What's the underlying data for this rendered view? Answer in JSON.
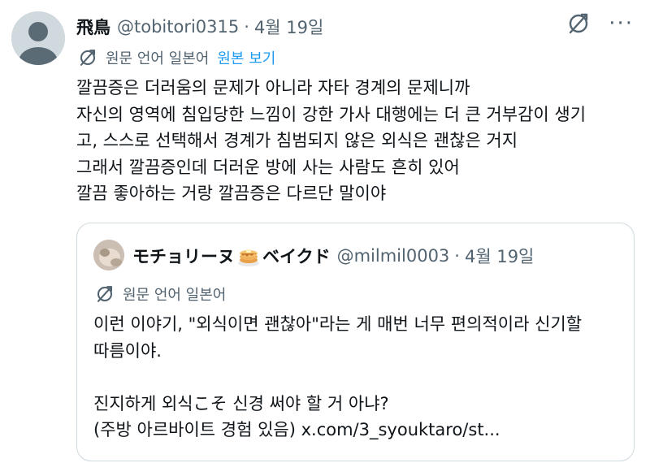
{
  "tweet": {
    "display_name": "飛鳥",
    "handle": "@tobitori0315",
    "separator": "·",
    "date": "4월 19일",
    "translate": {
      "label": "원문 언어 일본어",
      "show_original": "원본 보기"
    },
    "body_lines": [
      "깔끔증은 더러움의 문제가 아니라 자타 경계의 문제니까",
      "자신의 영역에 침입당한 느낌이 강한 가사 대행에는 더 큰 거부감이 생기",
      "고, 스스로 선택해서 경계가 침범되지 않은 외식은 괜찮은 거지",
      "그래서 깔끔증인데 더러운 방에 사는 사람도 흔히 있어",
      "깔끔 좋아하는 거랑 깔끔증은 다르단 말이야"
    ]
  },
  "top_icons": {
    "translate_icon": "translate-icon",
    "more": "···"
  },
  "quote": {
    "display_name_part1": "モチョリーヌ",
    "display_name_part2": "ベイクド",
    "emoji_icon": "pancake-icon",
    "handle": "@milmil0003",
    "separator": "·",
    "date": "4월 19일",
    "translate_label": "원문 언어 일본어",
    "body_lines": [
      "이런 이야기, \"외식이면 괜찮아\"라는 게 매번 너무 편의적이라 신기할",
      "따름이야.",
      "",
      "진지하게 외식こそ 신경 써야 할 거 아냐?",
      "(주방 아르바이트 경험 있음) x.com/3_syouktaro/st..."
    ]
  },
  "colors": {
    "text_primary": "#0f1419",
    "text_secondary": "#536471",
    "link": "#1d9bf0",
    "border": "#cfd9de"
  }
}
